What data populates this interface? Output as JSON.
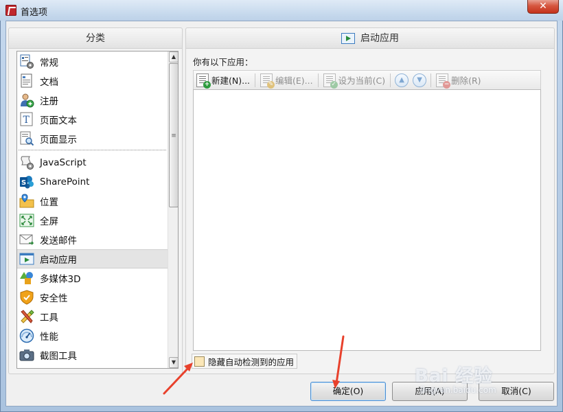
{
  "window": {
    "title": "首选项",
    "close_glyph": "✕"
  },
  "categories": {
    "header": "分类",
    "items": [
      {
        "label": "常规",
        "icon": "gear-doc-icon"
      },
      {
        "label": "文档",
        "icon": "document-icon"
      },
      {
        "label": "注册",
        "icon": "user-add-icon"
      },
      {
        "label": "页面文本",
        "icon": "text-T-icon"
      },
      {
        "label": "页面显示",
        "icon": "page-zoom-icon"
      },
      {
        "label": "JavaScript",
        "icon": "script-gear-icon"
      },
      {
        "label": "SharePoint",
        "icon": "sharepoint-icon"
      },
      {
        "label": "位置",
        "icon": "folder-pin-icon"
      },
      {
        "label": "全屏",
        "icon": "fullscreen-icon"
      },
      {
        "label": "发送邮件",
        "icon": "mail-icon"
      },
      {
        "label": "启动应用",
        "icon": "play-app-icon",
        "selected": true
      },
      {
        "label": "多媒体3D",
        "icon": "shapes-3d-icon"
      },
      {
        "label": "安全性",
        "icon": "shield-icon"
      },
      {
        "label": "工具",
        "icon": "tools-icon"
      },
      {
        "label": "性能",
        "icon": "gauge-icon"
      },
      {
        "label": "截图工具",
        "icon": "camera-icon"
      }
    ]
  },
  "launch": {
    "header": "启动应用",
    "list_label": "你有以下应用：",
    "toolbar": {
      "new": "新建(N)...",
      "edit": "编辑(E)...",
      "set_current": "设为当前(C)",
      "delete": "删除(R)"
    },
    "hide_detected_label": "隐藏自动检测到的应用"
  },
  "buttons": {
    "ok": "确定(O)",
    "apply": "应用(A)",
    "cancel": "取消(C)"
  },
  "watermark": {
    "brand": "Bai 经验",
    "url": "jingyan.baidu.com"
  },
  "colors": {
    "annotation_arrow": "#e8412c",
    "selection": "#e4e4e4",
    "checkbox_fill": "#fbe7b8"
  }
}
